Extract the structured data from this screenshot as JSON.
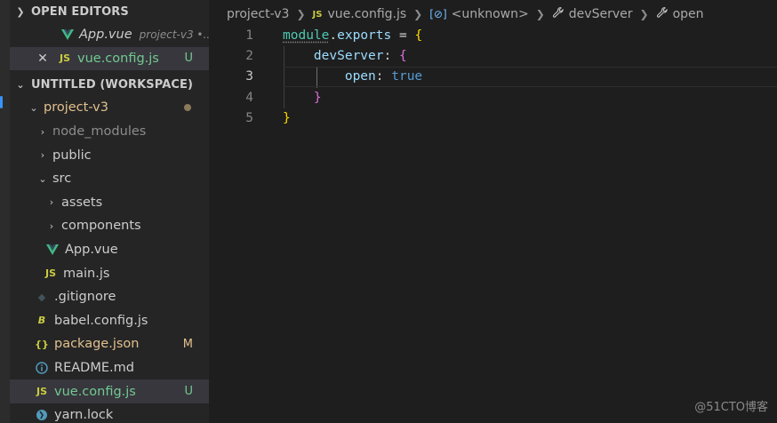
{
  "sidebar": {
    "open_editors": {
      "title": "OPEN EDITORS",
      "items": [
        {
          "name": "App.vue",
          "description": "project-v3 •..."
        },
        {
          "name": "vue.config.js",
          "badge": "U"
        }
      ]
    },
    "workspace": {
      "title": "UNTITLED (WORKSPACE)",
      "folder": "project-v3",
      "tree": [
        {
          "label": "node_modules"
        },
        {
          "label": "public"
        },
        {
          "label": "src"
        },
        {
          "label": "assets"
        },
        {
          "label": "components"
        },
        {
          "label": "App.vue"
        },
        {
          "label": "main.js"
        },
        {
          "label": ".gitignore"
        },
        {
          "label": "babel.config.js"
        },
        {
          "label": "package.json",
          "badge": "M"
        },
        {
          "label": "README.md"
        },
        {
          "label": "vue.config.js",
          "badge": "U"
        },
        {
          "label": "yarn.lock"
        }
      ]
    }
  },
  "breadcrumbs": {
    "folder": "project-v3",
    "file": "vue.config.js",
    "symbol1": "<unknown>",
    "symbol2": "devServer",
    "symbol3": "open"
  },
  "code": {
    "line_numbers": [
      "1",
      "2",
      "3",
      "4",
      "5"
    ],
    "module": "module",
    "exports": "exports",
    "devServer": "devServer",
    "open": "open",
    "true": "true"
  },
  "file_icons": {
    "js": "JS",
    "json": "{}"
  },
  "watermark": "@51CTO博客",
  "colors": {
    "untracked": "#73c991",
    "modified": "#e2c08d",
    "selected_row": "#37373d",
    "sidebar_bg": "#252526",
    "editor_bg": "#1e1e1e"
  }
}
